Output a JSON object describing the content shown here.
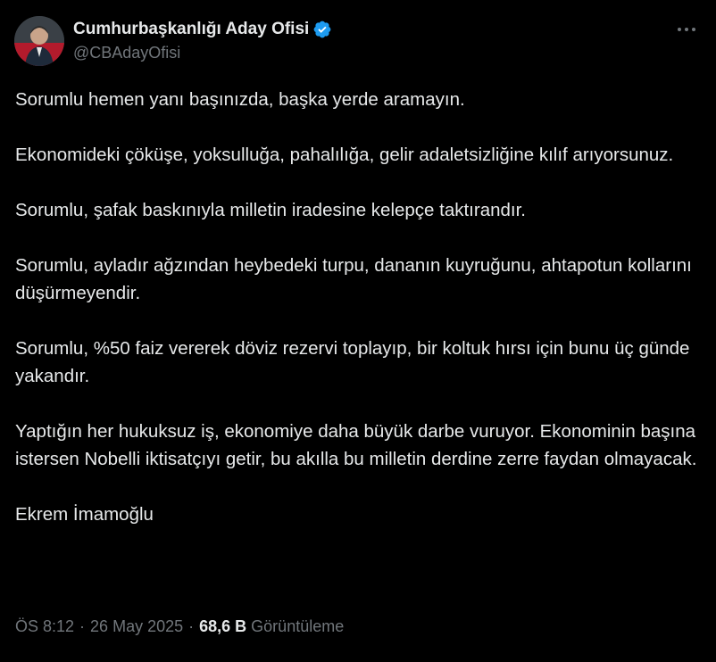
{
  "author": {
    "display_name": "Cumhurbaşkanlığı Aday Ofisi",
    "handle": "@CBAdayOfisi",
    "verified": true
  },
  "tweet": {
    "paragraphs": [
      "Sorumlu hemen yanı başınızda, başka yerde aramayın.",
      "Ekonomideki çöküşe, yoksulluğa, pahalılığa, gelir adaletsizliğine kılıf arıyorsunuz.",
      "Sorumlu, şafak baskınıyla milletin iradesine kelepçe taktırandır.",
      "Sorumlu, ayladır ağzından heybedeki turpu, dananın kuyruğunu, ahtapotun kollarını düşürmeyendir.",
      "Sorumlu, %50 faiz vererek döviz rezervi toplayıp, bir koltuk hırsı için bunu üç günde yakandır.",
      "Yaptığın her hukuksuz iş, ekonomiye daha büyük darbe vuruyor. Ekonominin başına istersen Nobelli iktisatçıyı getir, bu akılla bu milletin derdine zerre faydan olmayacak.",
      "Ekrem İmamoğlu"
    ]
  },
  "meta": {
    "time": "ÖS 8:12",
    "separator": "·",
    "date": "26 May 2025",
    "views_count": "68,6 B",
    "views_label": "Görüntüleme"
  },
  "colors": {
    "background": "#000000",
    "text_primary": "#e7e9ea",
    "text_secondary": "#71767b",
    "verified_badge": "#1d9bf0"
  },
  "icons": {
    "verified": "verified-badge-icon",
    "more": "more-options-icon"
  }
}
